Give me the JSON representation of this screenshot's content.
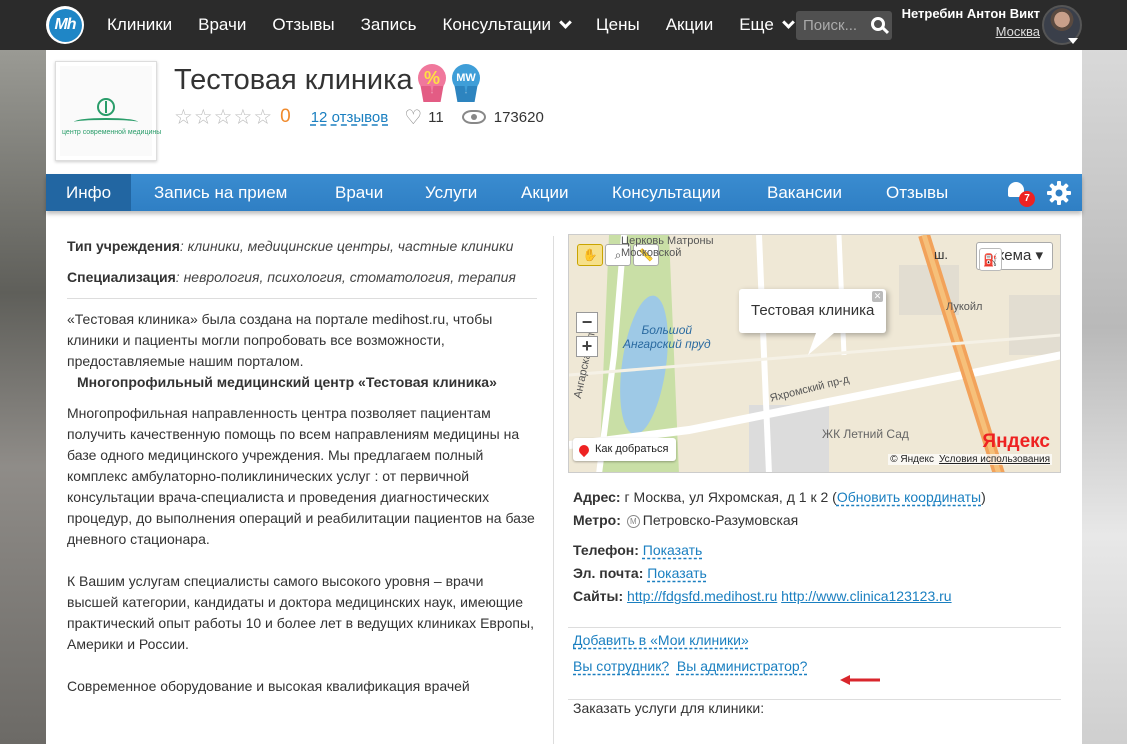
{
  "topnav": {
    "logo": "Mh",
    "items": [
      "Клиники",
      "Врачи",
      "Отзывы",
      "Запись",
      "Консультации",
      "Цены",
      "Акции",
      "Еще"
    ],
    "search_placeholder": "Поиск...",
    "user_name": "Нетребин Антон Викт",
    "user_city": "Москва"
  },
  "clinic": {
    "title": "Тестовая клиника",
    "logo_caption": "центр современной медицины",
    "badge_percent": "%",
    "badge_mw": "MW",
    "rating": "0",
    "reviews": "12 отзывов",
    "likes": "11",
    "views": "173620"
  },
  "tabs": {
    "items": [
      "Инфо",
      "Запись на прием",
      "Врачи",
      "Услуги",
      "Акции",
      "Консультации",
      "Вакансии",
      "Отзывы"
    ],
    "notifications": "7"
  },
  "info": {
    "type_label": "Тип учреждения",
    "type_value": ": клиники, медицинские центры, частные клиники",
    "spec_label": "Специализация",
    "spec_value": ": неврология, психология, стоматология, терапия",
    "p1": "«Тестовая клиника» была создана на портале medihost.ru, чтобы клиники и пациенты могли попробовать все возможности, предоставляемые нашим порталом.",
    "subhead": "Многопрофильный медицинский центр «Тестовая клиника»",
    "p2": "Многопрофильная направленность центра позволяет пациентам получить качественную помощь по всем направлениям медицины  на базе одного медицинского учреждения.  Мы предлагаем полный  комплекс амбулаторно-поликлинических услуг : от первичной консультации врача-специалиста и проведения диагностических процедур,  до выполнения операций и реабилитации пациентов на базе дневного стационара.",
    "p3": "К Вашим услугам специалисты самого высокого уровня – врачи высшей категории, кандидаты и доктора медицинских наук, имеющие практический опыт работы 10 и более лет в ведущих клиниках Европы, Америки и России.",
    "p4": "Современное оборудование и высокая квалификация врачей"
  },
  "map": {
    "schema": "Схема",
    "balloon": "Тестовая клиника",
    "route": "Как добраться",
    "brand": "Яндекс",
    "copyright": "© Яндекс",
    "terms": "Условия использования",
    "labels": {
      "lake": "Большой\nАнгарский пруд",
      "street1": "Ангарская ул.",
      "street2": "Яхромский пр-д",
      "park": "ЖК Летний Сад",
      "lukoil": "Лукойл",
      "church": "Церковь Матроны\nМосковской",
      "sh": "ш."
    }
  },
  "contacts": {
    "address_label": "Адрес:",
    "address_value": "г Москва, ул Яхромская, д 1 к 2",
    "update_coords": "Обновить координаты",
    "metro_label": "Метро:",
    "metro_value": "Петровско-Разумовская",
    "phone_label": "Телефон:",
    "email_label": "Эл. почта:",
    "show": "Показать",
    "sites_label": "Сайты:",
    "site1": "http://fdgsfd.medihost.ru",
    "site2": "http://www.clinica123123.ru"
  },
  "actions": {
    "add_my": "Добавить в «Мои клиники»",
    "employee": "Вы сотрудник?",
    "admin": "Вы администратор?",
    "order": "Заказать услуги для клиники:"
  },
  "colors": {
    "accent": "#2f7fc4",
    "active_tab": "#2266a2",
    "link": "#1a7fc0",
    "rating": "#f08a2c",
    "arrow": "#d9262c"
  }
}
